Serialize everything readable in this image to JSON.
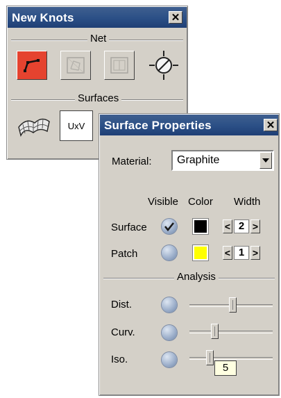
{
  "new_knots": {
    "title": "New Knots",
    "net_label": "Net",
    "surfaces_label": "Surfaces",
    "icons": [
      "curve-tool-icon",
      "net-grid-icon",
      "net-frame-icon",
      "target-icon",
      "surface-mesh-icon",
      "uxv-icon"
    ],
    "uxv_label": "UxV",
    "colors": {
      "active_tool": "#e5432f"
    }
  },
  "surface_properties": {
    "title": "Surface Properties",
    "material_label": "Material:",
    "material_value": "Graphite",
    "col_visible": "Visible",
    "col_color": "Color",
    "col_width": "Width",
    "rows": [
      {
        "label": "Surface",
        "visible": true,
        "color": "#000000",
        "width": "2"
      },
      {
        "label": "Patch",
        "visible": false,
        "color": "#ffff00",
        "width": "1"
      }
    ],
    "analysis_label": "Analysis",
    "analysis": [
      {
        "label": "Dist.",
        "value_fraction": 0.52
      },
      {
        "label": "Curv.",
        "value_fraction": 0.28
      },
      {
        "label": "Iso.",
        "value_fraction": 0.22,
        "value_text": "5"
      }
    ],
    "step_left": "<",
    "step_right": ">"
  },
  "close_glyph": "✕"
}
